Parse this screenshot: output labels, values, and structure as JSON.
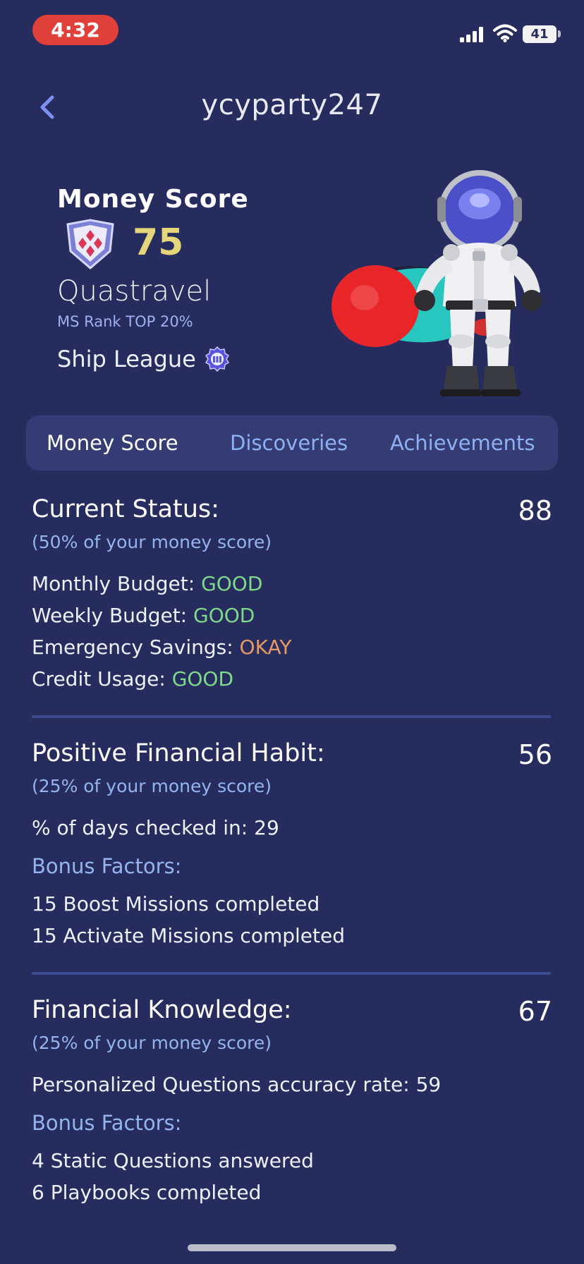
{
  "status_bar": {
    "time": "4:32",
    "battery": "41"
  },
  "header": {
    "username": "ycyparty247"
  },
  "profile": {
    "title": "Money Score",
    "score": "75",
    "rank_name": "Quastravel",
    "ms_rank": "MS Rank TOP 20%",
    "league": "Ship League"
  },
  "tabs": [
    {
      "label": "Money Score"
    },
    {
      "label": "Discoveries"
    },
    {
      "label": "Achievements"
    }
  ],
  "current_status": {
    "title": "Current Status:",
    "value": "88",
    "subtitle": "(50% of your money score)",
    "items": [
      {
        "label": "Monthly Budget: ",
        "status": "GOOD"
      },
      {
        "label": "Weekly Budget: ",
        "status": "GOOD"
      },
      {
        "label": "Emergency Savings: ",
        "status": "OKAY"
      },
      {
        "label": "Credit Usage: ",
        "status": "GOOD"
      }
    ]
  },
  "habit": {
    "title": "Positive Financial Habit:",
    "value": "56",
    "subtitle": "(25% of your money score)",
    "checked_in": "% of days checked in: 29",
    "bonus_title": "Bonus Factors:",
    "bonus_items": [
      "15 Boost Missions completed",
      "15 Activate Missions completed"
    ]
  },
  "knowledge": {
    "title": "Financial Knowledge:",
    "value": "67",
    "subtitle": "(25% of your money score)",
    "accuracy": "Personalized Questions accuracy rate: 59",
    "bonus_title": "Bonus Factors:",
    "bonus_items": [
      "4 Static Questions answered",
      "6 Playbooks completed"
    ]
  },
  "colors": {
    "background": "#262d5e",
    "tab_bar": "#343c73",
    "accent_blue": "#95b4ee",
    "score_gold": "#e5d67b",
    "good": "#7fd98a",
    "okay": "#e59a63",
    "time_pill": "#e0403a"
  }
}
